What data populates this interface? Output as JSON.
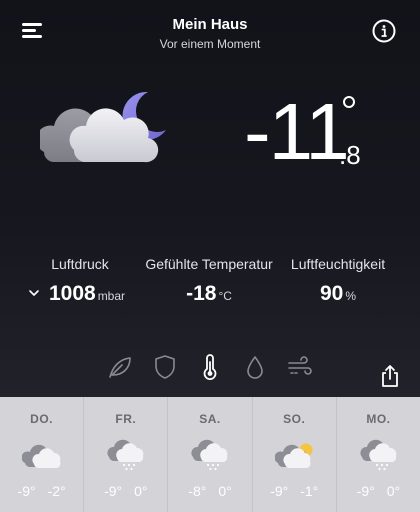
{
  "header": {
    "title": "Mein Haus",
    "subtitle": "Vor einem Moment",
    "menu_icon": "hamburger-menu-icon",
    "info_icon": "info-icon"
  },
  "current": {
    "condition_icon": "cloudy-night-moon-icon",
    "temp_integer": "-11",
    "temp_decimal": ".8"
  },
  "stats": {
    "pressure": {
      "label": "Luftdruck",
      "value": "1008",
      "unit": "mbar"
    },
    "feels_like": {
      "label": "Gefühlte Temperatur",
      "value": "-18",
      "unit": "°C"
    },
    "humidity": {
      "label": "Luftfeuchtigkeit",
      "value": "90",
      "unit": "%"
    }
  },
  "metrics": [
    "leaf-icon",
    "shield-icon",
    "thermometer-icon",
    "water-drop-icon",
    "wind-icon"
  ],
  "active_metric": "thermometer-icon",
  "share_icon": "share-icon",
  "forecast": [
    {
      "day": "DO.",
      "icon": "cloudy-icon",
      "low": "-9°",
      "high": "-2°"
    },
    {
      "day": "FR.",
      "icon": "snow-cloud-icon",
      "low": "-9°",
      "high": "0°"
    },
    {
      "day": "SA.",
      "icon": "snow-cloud-icon",
      "low": "-8°",
      "high": "0°"
    },
    {
      "day": "SO.",
      "icon": "partly-sunny-icon",
      "low": "-9°",
      "high": "-1°"
    },
    {
      "day": "MO.",
      "icon": "snow-cloud-icon",
      "low": "-9°",
      "high": "0°"
    }
  ],
  "colors": {
    "background_top": "#121219",
    "forecast_panel": "#d3d3d8",
    "moon": "#8a83e0",
    "sun": "#f5c542"
  }
}
